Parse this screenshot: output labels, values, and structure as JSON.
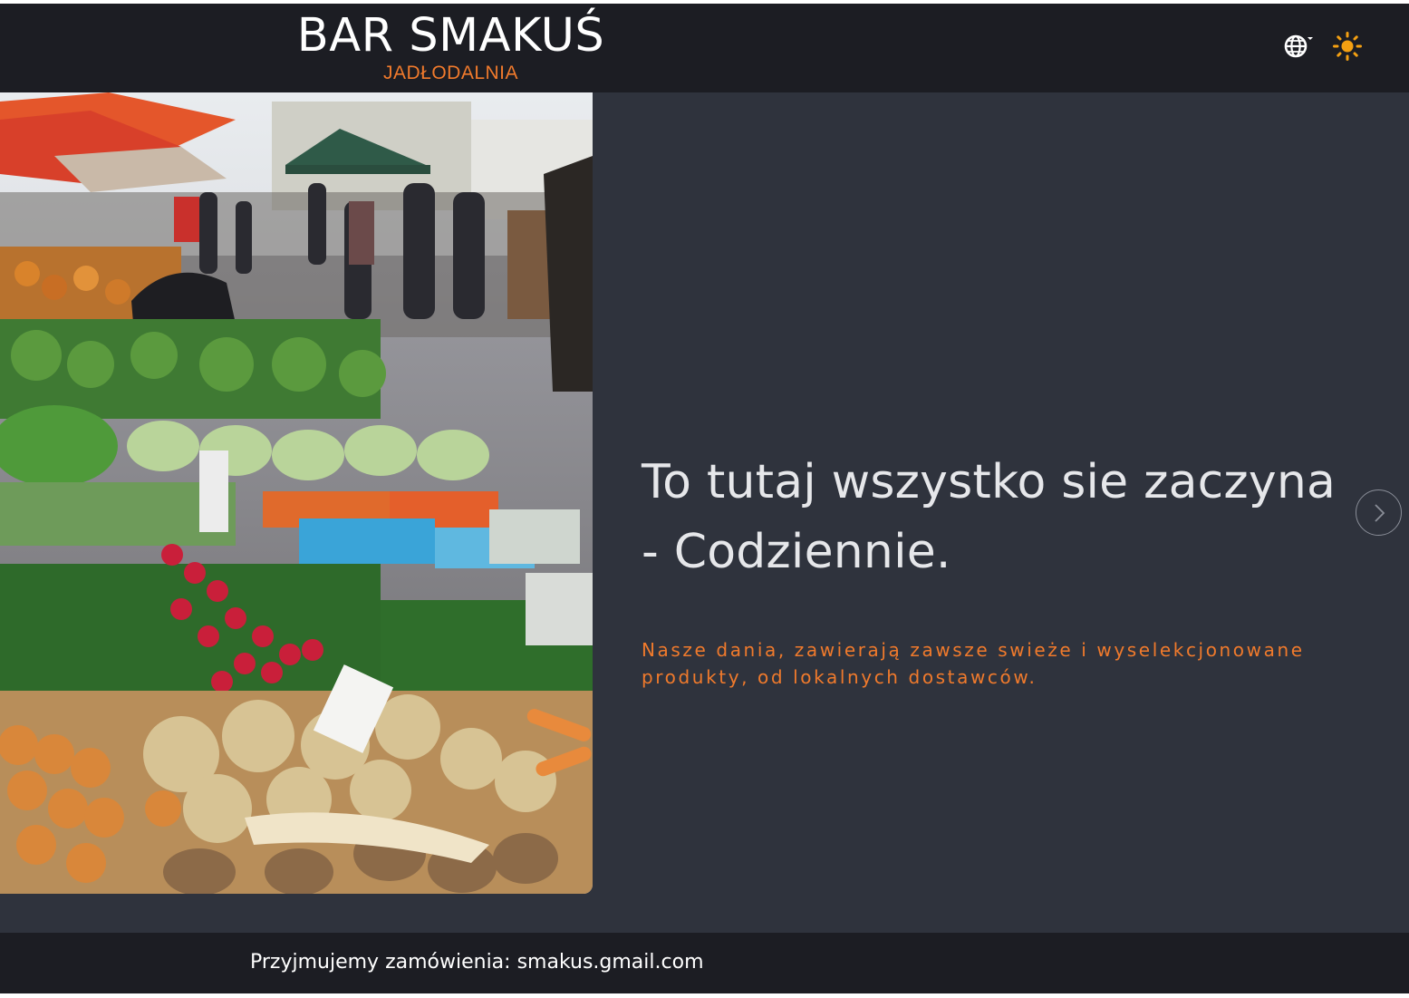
{
  "header": {
    "brand_name": "BAR SMAKUŚ",
    "brand_sub": "JADŁODALNIA",
    "language_icon": "globe-icon",
    "theme_icon": "sun-icon"
  },
  "hero": {
    "image": "market-vegetables-photo",
    "heading": "To tutaj wszystko sie zaczyna - Codziennie.",
    "subtext": "Nasze dania, zawierają zawsze swieże i wyselekcjonowane produkty, od lokalnych dostawców.",
    "next_icon": "chevron-right-icon"
  },
  "footer": {
    "contact_label": "Przyjmujemy zamówienia: ",
    "contact_email": "smakus.gmail.com"
  },
  "colors": {
    "accent": "#f07a2c",
    "header_bg": "#1c1d23",
    "hero_bg": "#2f333d",
    "text_light": "#e6e7ea"
  }
}
